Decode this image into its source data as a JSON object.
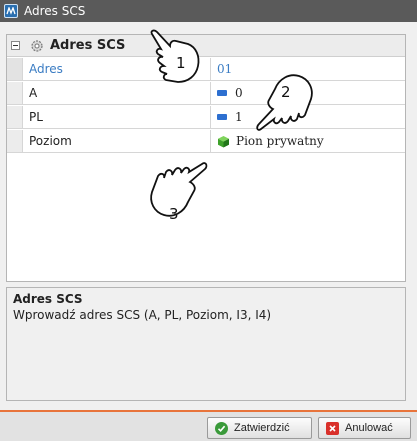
{
  "window": {
    "title": "Adres SCS"
  },
  "grid": {
    "header_label": "Adres SCS",
    "rows": [
      {
        "property": "Adres",
        "value": "01"
      },
      {
        "property": "A",
        "value": "0"
      },
      {
        "property": "PL",
        "value": "1"
      },
      {
        "property": "Poziom",
        "value": "Pion prywatny"
      }
    ]
  },
  "description": {
    "title": "Adres SCS",
    "text": "Wprowadź adres SCS (A, PL, Poziom, I3, I4)"
  },
  "buttons": {
    "confirm_label": "Zatwierdzić",
    "cancel_label": "Anulować"
  },
  "callouts": {
    "c1": "1",
    "c2": "2",
    "c3": "3"
  },
  "colors": {
    "accent": "#e8743b",
    "selected_text": "#3a7cc3",
    "flag_blue": "#2d6fd0"
  }
}
